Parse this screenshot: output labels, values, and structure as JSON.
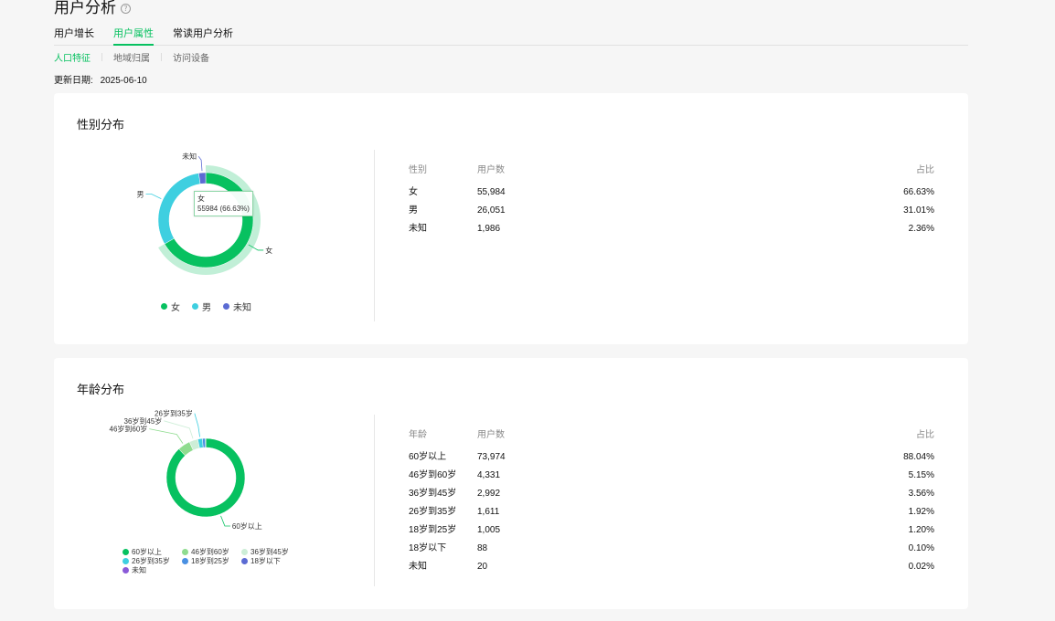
{
  "header": {
    "title": "用户分析",
    "help_icon": "?",
    "tabs": [
      {
        "label": "用户增长",
        "active": false
      },
      {
        "label": "用户属性",
        "active": true
      },
      {
        "label": "常读用户分析",
        "active": false
      }
    ],
    "subtabs": [
      {
        "label": "人口特征",
        "active": true
      },
      {
        "label": "地域归属",
        "active": false
      },
      {
        "label": "访问设备",
        "active": false
      }
    ],
    "update_label": "更新日期:",
    "update_date": "2025-06-10"
  },
  "colors": {
    "accent": "#07c160",
    "female": "#07c160",
    "male": "#3ecfe0",
    "unknown": "#5b6bd3",
    "age_60plus": "#07c160",
    "age_46_60": "#8fdc8f",
    "age_36_45": "#cdeed7",
    "age_26_35": "#3ecfe0",
    "age_18_25": "#4a90e2",
    "age_under18": "#5b6bd3",
    "age_unknown": "#8a5ad8"
  },
  "gender": {
    "title": "性别分布",
    "tooltip": {
      "name": "女",
      "value": "55984 (66.63%)"
    },
    "columns": [
      "性别",
      "用户数",
      "占比"
    ],
    "rows": [
      {
        "name": "女",
        "count": "55,984",
        "pct": "66.63%"
      },
      {
        "name": "男",
        "count": "26,051",
        "pct": "31.01%"
      },
      {
        "name": "未知",
        "count": "1,986",
        "pct": "2.36%"
      }
    ],
    "chart_data": {
      "type": "pie",
      "categories": [
        "女",
        "男",
        "未知"
      ],
      "values": [
        55984,
        26051,
        1986
      ],
      "legend": [
        "女",
        "男",
        "未知"
      ]
    }
  },
  "age": {
    "title": "年龄分布",
    "columns": [
      "年龄",
      "用户数",
      "占比"
    ],
    "rows": [
      {
        "name": "60岁以上",
        "count": "73,974",
        "pct": "88.04%"
      },
      {
        "name": "46岁到60岁",
        "count": "4,331",
        "pct": "5.15%"
      },
      {
        "name": "36岁到45岁",
        "count": "2,992",
        "pct": "3.56%"
      },
      {
        "name": "26岁到35岁",
        "count": "1,611",
        "pct": "1.92%"
      },
      {
        "name": "18岁到25岁",
        "count": "1,005",
        "pct": "1.20%"
      },
      {
        "name": "18岁以下",
        "count": "88",
        "pct": "0.10%"
      },
      {
        "name": "未知",
        "count": "20",
        "pct": "0.02%"
      }
    ],
    "chart_data": {
      "type": "pie",
      "categories": [
        "60岁以上",
        "46岁到60岁",
        "36岁到45岁",
        "26岁到35岁",
        "18岁到25岁",
        "18岁以下",
        "未知"
      ],
      "values": [
        73974,
        4331,
        2992,
        1611,
        1005,
        88,
        20
      ],
      "slice_labels": [
        "60岁以上",
        "46岁到60岁",
        "36岁到45岁",
        "26岁到35岁"
      ],
      "legend": [
        "60岁以上",
        "46岁到60岁",
        "36岁到45岁",
        "26岁到35岁",
        "18岁到25岁",
        "18岁以下",
        "未知"
      ]
    }
  }
}
